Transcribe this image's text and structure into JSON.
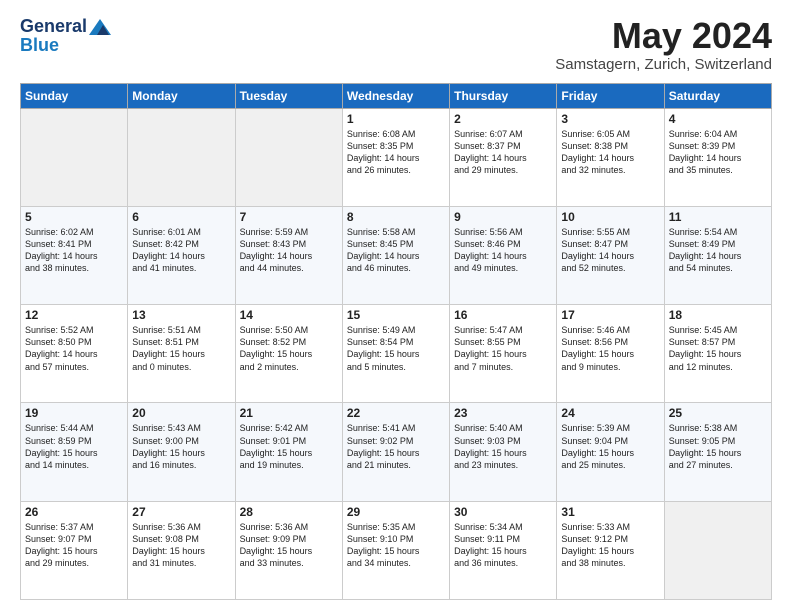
{
  "logo": {
    "general": "General",
    "blue": "Blue"
  },
  "header": {
    "title": "May 2024",
    "location": "Samstagern, Zurich, Switzerland"
  },
  "weekdays": [
    "Sunday",
    "Monday",
    "Tuesday",
    "Wednesday",
    "Thursday",
    "Friday",
    "Saturday"
  ],
  "weeks": [
    [
      {
        "day": "",
        "info": ""
      },
      {
        "day": "",
        "info": ""
      },
      {
        "day": "",
        "info": ""
      },
      {
        "day": "1",
        "info": "Sunrise: 6:08 AM\nSunset: 8:35 PM\nDaylight: 14 hours\nand 26 minutes."
      },
      {
        "day": "2",
        "info": "Sunrise: 6:07 AM\nSunset: 8:37 PM\nDaylight: 14 hours\nand 29 minutes."
      },
      {
        "day": "3",
        "info": "Sunrise: 6:05 AM\nSunset: 8:38 PM\nDaylight: 14 hours\nand 32 minutes."
      },
      {
        "day": "4",
        "info": "Sunrise: 6:04 AM\nSunset: 8:39 PM\nDaylight: 14 hours\nand 35 minutes."
      }
    ],
    [
      {
        "day": "5",
        "info": "Sunrise: 6:02 AM\nSunset: 8:41 PM\nDaylight: 14 hours\nand 38 minutes."
      },
      {
        "day": "6",
        "info": "Sunrise: 6:01 AM\nSunset: 8:42 PM\nDaylight: 14 hours\nand 41 minutes."
      },
      {
        "day": "7",
        "info": "Sunrise: 5:59 AM\nSunset: 8:43 PM\nDaylight: 14 hours\nand 44 minutes."
      },
      {
        "day": "8",
        "info": "Sunrise: 5:58 AM\nSunset: 8:45 PM\nDaylight: 14 hours\nand 46 minutes."
      },
      {
        "day": "9",
        "info": "Sunrise: 5:56 AM\nSunset: 8:46 PM\nDaylight: 14 hours\nand 49 minutes."
      },
      {
        "day": "10",
        "info": "Sunrise: 5:55 AM\nSunset: 8:47 PM\nDaylight: 14 hours\nand 52 minutes."
      },
      {
        "day": "11",
        "info": "Sunrise: 5:54 AM\nSunset: 8:49 PM\nDaylight: 14 hours\nand 54 minutes."
      }
    ],
    [
      {
        "day": "12",
        "info": "Sunrise: 5:52 AM\nSunset: 8:50 PM\nDaylight: 14 hours\nand 57 minutes."
      },
      {
        "day": "13",
        "info": "Sunrise: 5:51 AM\nSunset: 8:51 PM\nDaylight: 15 hours\nand 0 minutes."
      },
      {
        "day": "14",
        "info": "Sunrise: 5:50 AM\nSunset: 8:52 PM\nDaylight: 15 hours\nand 2 minutes."
      },
      {
        "day": "15",
        "info": "Sunrise: 5:49 AM\nSunset: 8:54 PM\nDaylight: 15 hours\nand 5 minutes."
      },
      {
        "day": "16",
        "info": "Sunrise: 5:47 AM\nSunset: 8:55 PM\nDaylight: 15 hours\nand 7 minutes."
      },
      {
        "day": "17",
        "info": "Sunrise: 5:46 AM\nSunset: 8:56 PM\nDaylight: 15 hours\nand 9 minutes."
      },
      {
        "day": "18",
        "info": "Sunrise: 5:45 AM\nSunset: 8:57 PM\nDaylight: 15 hours\nand 12 minutes."
      }
    ],
    [
      {
        "day": "19",
        "info": "Sunrise: 5:44 AM\nSunset: 8:59 PM\nDaylight: 15 hours\nand 14 minutes."
      },
      {
        "day": "20",
        "info": "Sunrise: 5:43 AM\nSunset: 9:00 PM\nDaylight: 15 hours\nand 16 minutes."
      },
      {
        "day": "21",
        "info": "Sunrise: 5:42 AM\nSunset: 9:01 PM\nDaylight: 15 hours\nand 19 minutes."
      },
      {
        "day": "22",
        "info": "Sunrise: 5:41 AM\nSunset: 9:02 PM\nDaylight: 15 hours\nand 21 minutes."
      },
      {
        "day": "23",
        "info": "Sunrise: 5:40 AM\nSunset: 9:03 PM\nDaylight: 15 hours\nand 23 minutes."
      },
      {
        "day": "24",
        "info": "Sunrise: 5:39 AM\nSunset: 9:04 PM\nDaylight: 15 hours\nand 25 minutes."
      },
      {
        "day": "25",
        "info": "Sunrise: 5:38 AM\nSunset: 9:05 PM\nDaylight: 15 hours\nand 27 minutes."
      }
    ],
    [
      {
        "day": "26",
        "info": "Sunrise: 5:37 AM\nSunset: 9:07 PM\nDaylight: 15 hours\nand 29 minutes."
      },
      {
        "day": "27",
        "info": "Sunrise: 5:36 AM\nSunset: 9:08 PM\nDaylight: 15 hours\nand 31 minutes."
      },
      {
        "day": "28",
        "info": "Sunrise: 5:36 AM\nSunset: 9:09 PM\nDaylight: 15 hours\nand 33 minutes."
      },
      {
        "day": "29",
        "info": "Sunrise: 5:35 AM\nSunset: 9:10 PM\nDaylight: 15 hours\nand 34 minutes."
      },
      {
        "day": "30",
        "info": "Sunrise: 5:34 AM\nSunset: 9:11 PM\nDaylight: 15 hours\nand 36 minutes."
      },
      {
        "day": "31",
        "info": "Sunrise: 5:33 AM\nSunset: 9:12 PM\nDaylight: 15 hours\nand 38 minutes."
      },
      {
        "day": "",
        "info": ""
      }
    ]
  ]
}
